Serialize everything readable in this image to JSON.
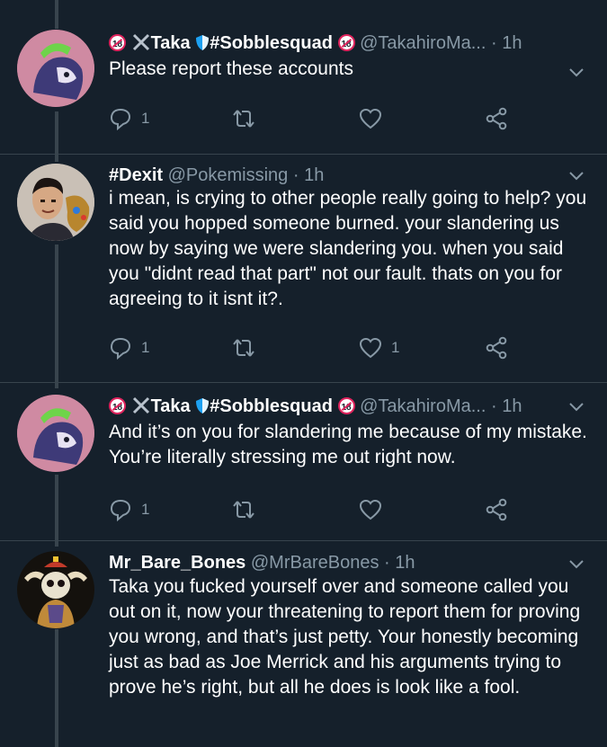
{
  "tweets": [
    {
      "display_name": "Taka",
      "hashtag_name": "#Sobblesquad",
      "badge_text": "18",
      "handle": "@TakahiroMa...",
      "separator": "·",
      "time": "1h",
      "text": "Please report these accounts",
      "reply_count": "1",
      "retweet_count": "",
      "like_count": "",
      "avatar": "pink-character-avatar"
    },
    {
      "display_name": "#Dexit",
      "handle": "@Pokemissing",
      "separator": "·",
      "time": "1h",
      "text": "i mean, is crying to other people really going to help? you said you hopped someone burned. your slandering us now by saying we were slandering you. when you said you \"didnt read that part\" not our fault. thats on you for agreeing to it isnt it?.",
      "reply_count": "1",
      "retweet_count": "",
      "like_count": "1",
      "avatar": "person-gauntlet-avatar"
    },
    {
      "display_name": "Taka",
      "hashtag_name": "#Sobblesquad",
      "badge_text": "18",
      "handle": "@TakahiroMa...",
      "separator": "·",
      "time": "1h",
      "text": "And it’s on you for slandering me because of my mistake. You’re literally stressing me out right now.",
      "reply_count": "1",
      "retweet_count": "",
      "like_count": "",
      "avatar": "pink-character-avatar"
    },
    {
      "display_name": "Mr_Bare_Bones",
      "handle": "@MrBareBones",
      "separator": "·",
      "time": "1h",
      "text": "Taka you fucked yourself over and someone called you out on it, now your threatening to report them for proving you wrong, and that’s just petty. Your honestly becoming just as bad as Joe Merrick and his arguments trying to prove he’s right, but all he does is look like a fool.",
      "avatar": "skeleton-avatar"
    }
  ],
  "colors": {
    "background": "#15202b",
    "text": "#ffffff",
    "secondary": "#8899a6",
    "line": "#38444d",
    "badge_red": "#e0245e",
    "shield_blue": "#1da1f2"
  }
}
